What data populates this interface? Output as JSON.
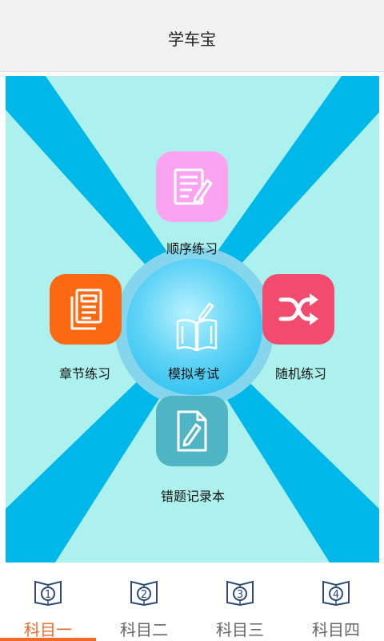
{
  "header": {
    "title": "学车宝"
  },
  "menu": {
    "sequential": {
      "label": "顺序练习",
      "icon": "notepad-pencil-icon",
      "color": "#f9a3f1"
    },
    "chapter": {
      "label": "章节练习",
      "icon": "document-list-icon",
      "color": "#fb6a13"
    },
    "random": {
      "label": "随机练习",
      "icon": "shuffle-icon",
      "color": "#f24b6e"
    },
    "exam": {
      "label": "模拟考试",
      "icon": "open-book-icon"
    },
    "mistakes": {
      "label": "错题记录本",
      "icon": "document-edit-icon",
      "color": "#4fb5c5"
    }
  },
  "tabs": [
    {
      "label": "科目一",
      "number": "1",
      "active": true
    },
    {
      "label": "科目二",
      "number": "2",
      "active": false
    },
    {
      "label": "科目三",
      "number": "3",
      "active": false
    },
    {
      "label": "科目四",
      "number": "4",
      "active": false
    }
  ],
  "colors": {
    "accent": "#f06a2a",
    "background": "#adf1ee",
    "rays": "#00b7ea"
  }
}
